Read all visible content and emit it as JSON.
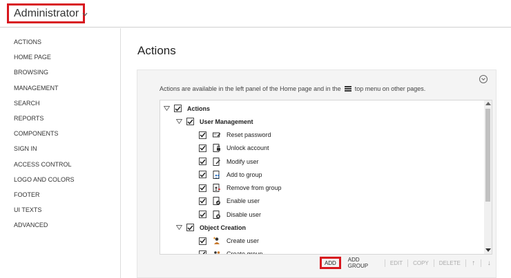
{
  "header": {
    "role_label": "Administrator",
    "role_chevron": "chevron-down-icon",
    "highlight_color": "#d8171e"
  },
  "sidebar": {
    "items": [
      {
        "label": "ACTIONS"
      },
      {
        "label": "HOME PAGE"
      },
      {
        "label": "BROWSING"
      },
      {
        "label": "MANAGEMENT"
      },
      {
        "label": "SEARCH"
      },
      {
        "label": "REPORTS"
      },
      {
        "label": "COMPONENTS"
      },
      {
        "label": "SIGN IN"
      },
      {
        "label": "ACCESS CONTROL"
      },
      {
        "label": "LOGO AND COLORS"
      },
      {
        "label": "FOOTER"
      },
      {
        "label": "UI TEXTS"
      },
      {
        "label": "ADVANCED"
      }
    ]
  },
  "main": {
    "title": "Actions",
    "description_before": "Actions are available in the left panel of the Home page and in the",
    "description_icon": "hamburger-menu-icon",
    "description_after": "top menu on other pages."
  },
  "tree": {
    "nodes": [
      {
        "label": "Actions",
        "level": 0,
        "expanded": true,
        "checked": true,
        "bold": true
      },
      {
        "label": "User Management",
        "level": 1,
        "expanded": true,
        "checked": true,
        "bold": true
      },
      {
        "label": "Reset password",
        "level": 2,
        "checked": true,
        "icon": "reset-password-icon"
      },
      {
        "label": "Unlock account",
        "level": 2,
        "checked": true,
        "icon": "unlock-account-icon"
      },
      {
        "label": "Modify user",
        "level": 2,
        "checked": true,
        "icon": "modify-user-icon"
      },
      {
        "label": "Add to group",
        "level": 2,
        "checked": true,
        "icon": "add-to-group-icon"
      },
      {
        "label": "Remove from group",
        "level": 2,
        "checked": true,
        "icon": "remove-from-group-icon"
      },
      {
        "label": "Enable user",
        "level": 2,
        "checked": true,
        "icon": "enable-user-icon"
      },
      {
        "label": "Disable user",
        "level": 2,
        "checked": true,
        "icon": "disable-user-icon"
      },
      {
        "label": "Object Creation",
        "level": 1,
        "expanded": true,
        "checked": true,
        "bold": true
      },
      {
        "label": "Create user",
        "level": 2,
        "checked": true,
        "icon": "create-user-icon"
      },
      {
        "label": "Create group",
        "level": 2,
        "checked": true,
        "icon": "create-group-icon"
      }
    ]
  },
  "toolbar": {
    "add": "ADD",
    "add_group": "ADD GROUP",
    "edit": "EDIT",
    "copy": "COPY",
    "delete": "DELETE",
    "move_up": "↑",
    "move_down": "↓"
  }
}
